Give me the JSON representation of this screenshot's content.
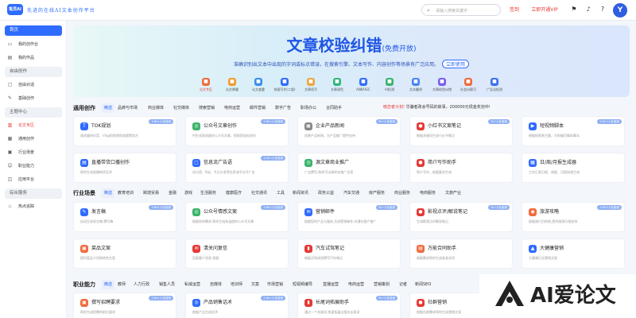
{
  "header": {
    "logo_text": "笔灵AI",
    "slogan": "先进的在线AI文本创作平台",
    "search_placeholder": "请输入搜索关键字",
    "signin": "签到",
    "vip": "立即开通VIP",
    "avatar": "Y"
  },
  "sidebar": {
    "home": "首页",
    "items_top": [
      {
        "label": "我的创作台",
        "icon": "monitor-icon"
      },
      {
        "label": "我的作品",
        "icon": "folder-icon"
      }
    ],
    "free_section": "自由创作",
    "free_items": [
      {
        "label": "自由对话",
        "icon": "chat-icon"
      },
      {
        "label": "基础创作",
        "icon": "pen-icon"
      }
    ],
    "theme_section": "主题中心",
    "theme_items": [
      {
        "label": "论文专区",
        "icon": "doc-icon"
      },
      {
        "label": "通用创作",
        "icon": "grid-icon"
      },
      {
        "label": "行业场景",
        "icon": "briefcase-icon"
      },
      {
        "label": "职业能力",
        "icon": "user-icon"
      },
      {
        "label": "应用平台",
        "icon": "app-icon"
      }
    ],
    "combo_section": "综合服务",
    "combo_items": [
      {
        "label": "热点追踪",
        "icon": "fire-icon"
      }
    ]
  },
  "banner": {
    "title": "文章校验纠错",
    "free": "(免费开放)",
    "subtitle": "准确识别出文本中出现的字词或标点错误，在搜索引擎、文本写作、内容创作等场景有广泛应用。",
    "use_btn": "立即使用",
    "icons": [
      {
        "label": "论文专区",
        "color": "#f06b3c",
        "active": true
      },
      {
        "label": "论文降重",
        "color": "#f39a2c"
      },
      {
        "label": "论文查重",
        "color": "#3a8df0"
      },
      {
        "label": "快速写作(二版)",
        "color": "#2f6bff"
      },
      {
        "label": "文章续写",
        "color": "#f0a53c"
      },
      {
        "label": "文章润色",
        "color": "#33b57a"
      },
      {
        "label": "AI降AIGC",
        "color": "#2f6bff"
      },
      {
        "label": "AI检测",
        "color": "#3cb36b"
      },
      {
        "label": "文本翻译",
        "color": "#4b83f0"
      },
      {
        "label": "文章校验纠错",
        "color": "#7a5cf0"
      },
      {
        "label": "社会纠察可",
        "color": "#f06b3c"
      },
      {
        "label": "广告法检测",
        "color": "#3a6ff0"
      }
    ]
  },
  "general": {
    "title": "通用创作",
    "tabs": [
      "精选",
      "品牌与市场",
      "商业媒体",
      "社交媒体",
      "搜索营销",
      "电商运营",
      "邮件营销",
      "数字广告",
      "职场办公",
      "合同助手"
    ],
    "notice_hot": "暗恋者计划!",
    "notice": "华骗者政会号码的故事，200000元现金奖池中!",
    "cards": [
      {
        "title": "TOK规划",
        "desc": "高质量的抖音、Vlog短视频和选题策划方",
        "icon": "T",
        "color": "#2f6bff",
        "tag": "3.8k+人在使用"
      },
      {
        "title": "公众号文章创作",
        "desc": "AI生成高质量的公众号文章，帮助您轻松创作",
        "icon": "◎",
        "color": "#3cb36b",
        "tag": "2.6k+人在使用"
      },
      {
        "title": "企业产品新闻",
        "desc": "创建产品新闻，为产品推广提供支持",
        "icon": "▣",
        "color": "#888888",
        "tag": "3k+人在使用"
      },
      {
        "title": "小红书文案笔记",
        "desc": "根据关键词生成小红书笔记",
        "icon": "●",
        "color": "#e53935",
        "tag": "7k+人在使用"
      },
      {
        "title": "短视频脚本",
        "desc": "根据短视频主题，为你编写精彩脚本",
        "icon": "▶",
        "color": "#2f6bff",
        "tag": "3.5k+人在使用"
      },
      {
        "title": "直播带货口播创作",
        "desc": "帮你生成直播带货话术",
        "icon": "▤",
        "color": "#2f6bff",
        "tag": ""
      },
      {
        "title": "信息流广告语",
        "desc": "在抖音、B站、今日头条等信息流平台写广告",
        "icon": "▢",
        "color": "#2f6bff",
        "tag": "2.2k+人在使用"
      },
      {
        "title": "源文章商业推广",
        "desc": "广告撰写,帮你写出高转化推广文案",
        "icon": "◎",
        "color": "#3cb36b",
        "tag": ""
      },
      {
        "title": "简介写作助手",
        "desc": "简介写作，根据要求生成",
        "icon": "●",
        "color": "#e53935",
        "tag": ""
      },
      {
        "title": "日/周/月报生成器",
        "desc": "工作汇报日报、周报、月报快速生成",
        "icon": "▦",
        "color": "#2f6bff",
        "tag": ""
      }
    ]
  },
  "industry": {
    "title": "行业场景",
    "tabs": [
      "精选",
      "教育培训",
      "跨境贸易",
      "金融",
      "游戏",
      "生活服务",
      "健康医疗",
      "社交通讯",
      "工具",
      "新闻资讯",
      "政务公益",
      "汽车交通",
      "房产服务",
      "商业服务",
      "电商服务",
      "文旅产业"
    ],
    "cards": [
      {
        "title": "发言稿",
        "desc": "自动生成发言稿,撰写稿",
        "icon": "✎",
        "color": "#2f6bff",
        "tag": "3.8k+人在使用"
      },
      {
        "title": "公众号情感文案",
        "desc": "根据你的需求,帮你生成有温度的公众号文章",
        "icon": "◎",
        "color": "#3cb36b",
        "tag": "2.6k+人在使用"
      },
      {
        "title": "营销邮件",
        "desc": "根据您的产品与服务,生成营销邮件,向潜在客户推广",
        "icon": "✉",
        "color": "#2f6bff",
        "tag": "3k+人在使用"
      },
      {
        "title": "影视点评/解说笔记",
        "desc": "生成影视点评解说笔记",
        "icon": "●",
        "color": "#e53935",
        "tag": "7k+人在使用"
      },
      {
        "title": "旅游攻略",
        "desc": "根据旅行目的地,提供旅游行程安排",
        "icon": "◉",
        "color": "#f06b3c",
        "tag": "3.5k+人在使用"
      },
      {
        "title": "菜品文案",
        "desc": "提供菜品介绍和特色文案",
        "icon": "▣",
        "color": "#f06b3c",
        "tag": ""
      },
      {
        "title": "清关问复信",
        "desc": "回复客户消息,答疑",
        "icon": "✉",
        "color": "#e53935",
        "tag": ""
      },
      {
        "title": "汽车试驾笔记",
        "desc": "根据试驾体验撰写汽车笔记",
        "icon": "▮",
        "color": "#e53935",
        "tag": ""
      },
      {
        "title": "万能合同助手",
        "desc": "根据需求帮你生成各类合同",
        "icon": "▤",
        "color": "#f06b3c",
        "tag": ""
      },
      {
        "title": "大健康营销",
        "desc": "大健康行业营销文案",
        "icon": "▲",
        "color": "#2f6bff",
        "tag": ""
      }
    ]
  },
  "career": {
    "title": "职业能力",
    "tabs": [
      "精选",
      "教师",
      "人力行政",
      "销售人员",
      "私域运营",
      "自媒体",
      "培训师",
      "文案",
      "市场营销",
      "短视频编导",
      "直播运营",
      "电商运营",
      "营销策划",
      "记者",
      "新闻SEO"
    ],
    "cards": [
      {
        "title": "撰写招聘要求",
        "desc": "帮你生成招聘的职位要求",
        "icon": "▣",
        "color": "#f06b3c",
        "tag": "3.8k+人在使用"
      },
      {
        "title": "产品销售话术",
        "desc": "根据产品生成话术",
        "icon": "◎",
        "color": "#2f6bff",
        "tag": "2.6k+人在使用"
      },
      {
        "title": "长尾词拓展助手",
        "desc": "通过一个关键词,快速拓展出相关长尾词",
        "icon": "▮",
        "color": "#e53935",
        "tag": "3k+人在使用"
      },
      {
        "title": "社群营销",
        "desc": "根据社群需求帮你生成营销文案",
        "icon": "●",
        "color": "#e53935",
        "tag": ""
      }
    ]
  },
  "watermark": {
    "text": "AI爱论文"
  }
}
